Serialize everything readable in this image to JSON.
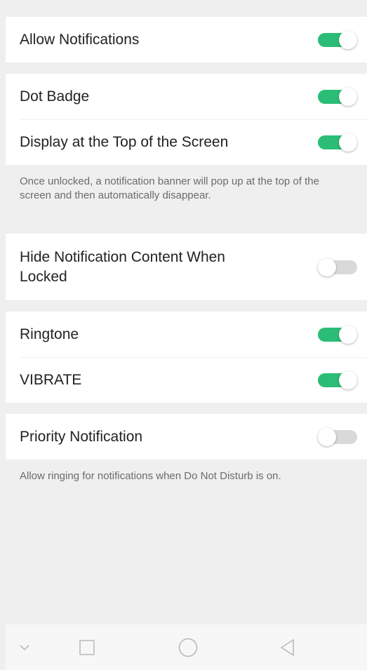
{
  "sections": {
    "allow_notifications": {
      "label": "Allow Notifications",
      "enabled": true
    },
    "dot_badge": {
      "label": "Dot Badge",
      "enabled": true
    },
    "display_top": {
      "label": "Display at the Top of the Screen",
      "enabled": true
    },
    "display_top_desc": "Once unlocked, a notification banner will pop up at the top of the screen and then automatically disappear.",
    "hide_content": {
      "label": "Hide Notification Content When Locked",
      "enabled": false
    },
    "ringtone": {
      "label": "Ringtone",
      "enabled": true
    },
    "vibrate": {
      "label": "VIBRATE",
      "enabled": true
    },
    "priority": {
      "label": "Priority Notification",
      "enabled": false
    },
    "priority_desc": "Allow ringing for notifications when Do Not Disturb is on."
  },
  "navbar": {
    "icons": [
      "chevron-down-icon",
      "square-icon",
      "circle-icon",
      "triangle-back-icon"
    ]
  },
  "colors": {
    "toggle_on": "#2bbd75",
    "toggle_off": "#d9d9d9",
    "background": "#efefef",
    "card": "#ffffff"
  }
}
